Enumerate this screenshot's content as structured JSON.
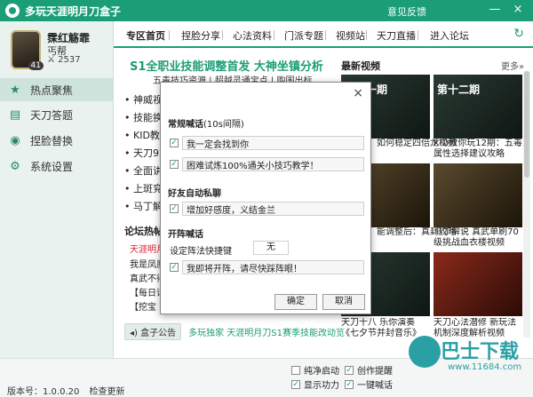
{
  "window": {
    "title": "多玩天涯明月刀盒子",
    "feedback": "意见反馈",
    "min": "—",
    "close": "×"
  },
  "user": {
    "name": "霂红觞霏",
    "role": "丐帮",
    "points": "2537",
    "level": "41"
  },
  "sidebar": {
    "items": [
      {
        "label": "热点聚焦",
        "icon": "star-icon"
      },
      {
        "label": "天刀答题",
        "icon": "document-icon"
      },
      {
        "label": "捏脸替换",
        "icon": "face-icon"
      },
      {
        "label": "系统设置",
        "icon": "gear-icon"
      }
    ]
  },
  "tabs": [
    "专区首页",
    "捏脸分享",
    "心法资料",
    "门派专题",
    "视频站",
    "天刀直播",
    "进入论坛"
  ],
  "news": {
    "headline": "S1全职业技能调整首发 大神坐镇分析",
    "subline": "五毒技巧资源 | 超越灵通宝点 | 购围出标",
    "items": [
      "神威视",
      "技能换",
      "KID教你",
      "天刀92",
      "全面讲",
      "上斑兖",
      "马丁解"
    ],
    "hot_title": "论坛热帖",
    "hot_items": [
      "天涯明月",
      "我是凤凰",
      "真武不得",
      "【每日话",
      "【挖宝"
    ]
  },
  "notice": {
    "label": "盒子公告",
    "text": "多玩独家 天涯明月刀S1赛季技能改动览"
  },
  "videos": {
    "title": "最新视频",
    "more": "更多»",
    "list": [
      {
        "thumb": "第十一期",
        "caption": "如何稳定四倍龙视频"
      },
      {
        "thumb": "第十二期",
        "caption": "KID教你玩12期：五毒属性选择建议攻略"
      },
      {
        "thumb": "",
        "caption": "能调整后：真封攻略"
      },
      {
        "thumb": "",
        "caption": "马丁解说 真武单刷70级挑战血衣楼视频"
      },
      {
        "thumb": "",
        "caption": "天刀十八 乐你演奏《七夕节并封音乐》"
      },
      {
        "thumb": "",
        "caption": "天刀心法潜修 新玩法机制深度解析视频"
      }
    ]
  },
  "footer": {
    "version_label": "版本号：",
    "version": "1.0.0.20",
    "check_update": "检查更新",
    "checks": [
      {
        "label": "纯净启动",
        "checked": false
      },
      {
        "label": "创作提醒",
        "checked": true
      },
      {
        "label": "显示功力",
        "checked": true
      },
      {
        "label": "一键喊话",
        "checked": true
      }
    ]
  },
  "watermark": {
    "text": "巴士下载",
    "url": "www.11684.com"
  },
  "modal": {
    "close": "×",
    "section1": "常规喊话",
    "section1_sub": "(10s间隔)",
    "row1": "我一定会找到你",
    "row2": "困难试炼100%通关小技巧教学！",
    "section2": "好友自动私聊",
    "row3": "增加好感度，义结金兰",
    "section3": "开阵喊话",
    "hotkey_label": "设定阵法快捷键",
    "hotkey_value": "无",
    "row4": "我即将开阵，请尽快踩阵眼！",
    "ok": "确定",
    "cancel": "取消"
  }
}
